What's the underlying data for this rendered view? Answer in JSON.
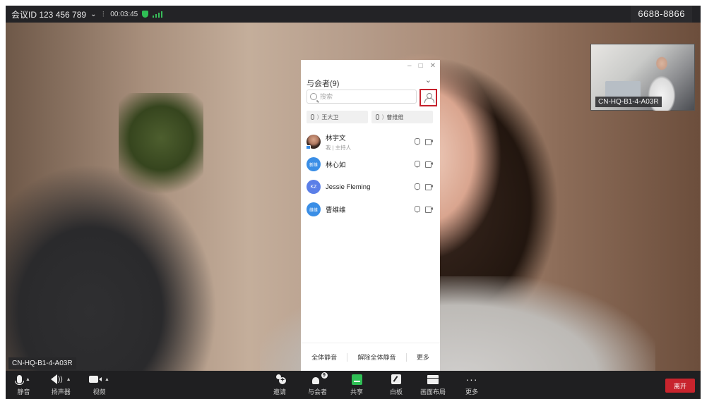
{
  "topbar": {
    "meeting_id": "会议ID 123 456 789",
    "timer": "00:03:45",
    "room_number": "6688-8866"
  },
  "self_view": {
    "label": "CN-HQ-B1-4-A03R"
  },
  "main_video": {
    "name_tag": "CN-HQ-B1-4-A03R"
  },
  "panel": {
    "title": "与会者(9)",
    "search_placeholder": "搜索",
    "speaking": [
      "王大卫",
      "曹维维"
    ],
    "participants": [
      {
        "name": "林宇文",
        "subtitle": "我 | 主持人",
        "avatar": "photo",
        "avatar_text": ""
      },
      {
        "name": "林心如",
        "subtitle": "",
        "avatar": "blue",
        "avatar_text": "新维"
      },
      {
        "name": "Jessie Fleming",
        "subtitle": "",
        "avatar": "kz",
        "avatar_text": "KZ"
      },
      {
        "name": "曹维维",
        "subtitle": "",
        "avatar": "blue",
        "avatar_text": "维维"
      }
    ],
    "footer": {
      "mute_all": "全体静音",
      "unmute_all": "解除全体静音",
      "more": "更多"
    }
  },
  "toolbar": {
    "mute": "静音",
    "speaker": "扬声器",
    "video": "视频",
    "invite": "邀请",
    "participants": "与会者",
    "participants_badge": "9",
    "share": "共享",
    "whiteboard": "白板",
    "layout": "画面布局",
    "more": "更多",
    "leave": "离开"
  },
  "colors": {
    "accent_red": "#c8242d",
    "share_green": "#2fbf55",
    "avatar_blue": "#3a8ee6"
  }
}
